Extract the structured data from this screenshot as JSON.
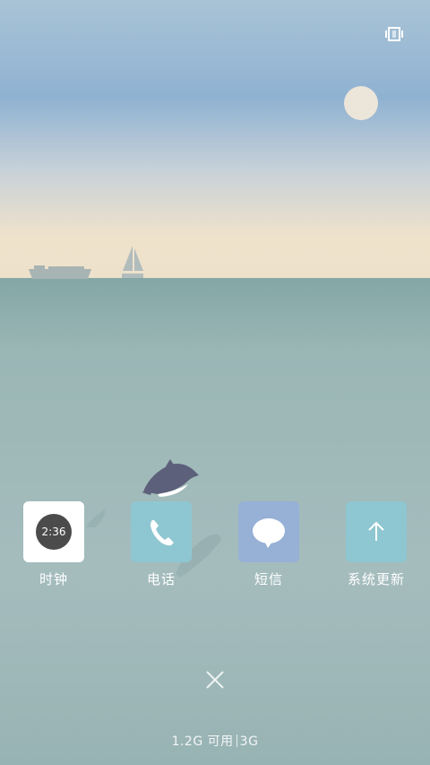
{
  "status_bar": {
    "icon": "vibrate-icon"
  },
  "apps": [
    {
      "label": "时钟",
      "icon": "clock-icon",
      "clock_text": "2:36",
      "tile_color": "#ffffff"
    },
    {
      "label": "电话",
      "icon": "phone-icon",
      "tile_color": "#8ec7d1"
    },
    {
      "label": "短信",
      "icon": "message-icon",
      "tile_color": "#97b0d6"
    },
    {
      "label": "系统更新",
      "icon": "arrow-up-icon",
      "tile_color": "#8ec7d1"
    }
  ],
  "close_button": {
    "icon": "close-icon"
  },
  "memory_status": {
    "available": "1.2G 可用",
    "network": "3G"
  },
  "colors": {
    "sky_top": "#8fb2d2",
    "horizon": "#efe2cb",
    "sea_top": "#8fb0ae",
    "sea_bottom": "#9fb8b9",
    "sun": "#ece6da"
  }
}
